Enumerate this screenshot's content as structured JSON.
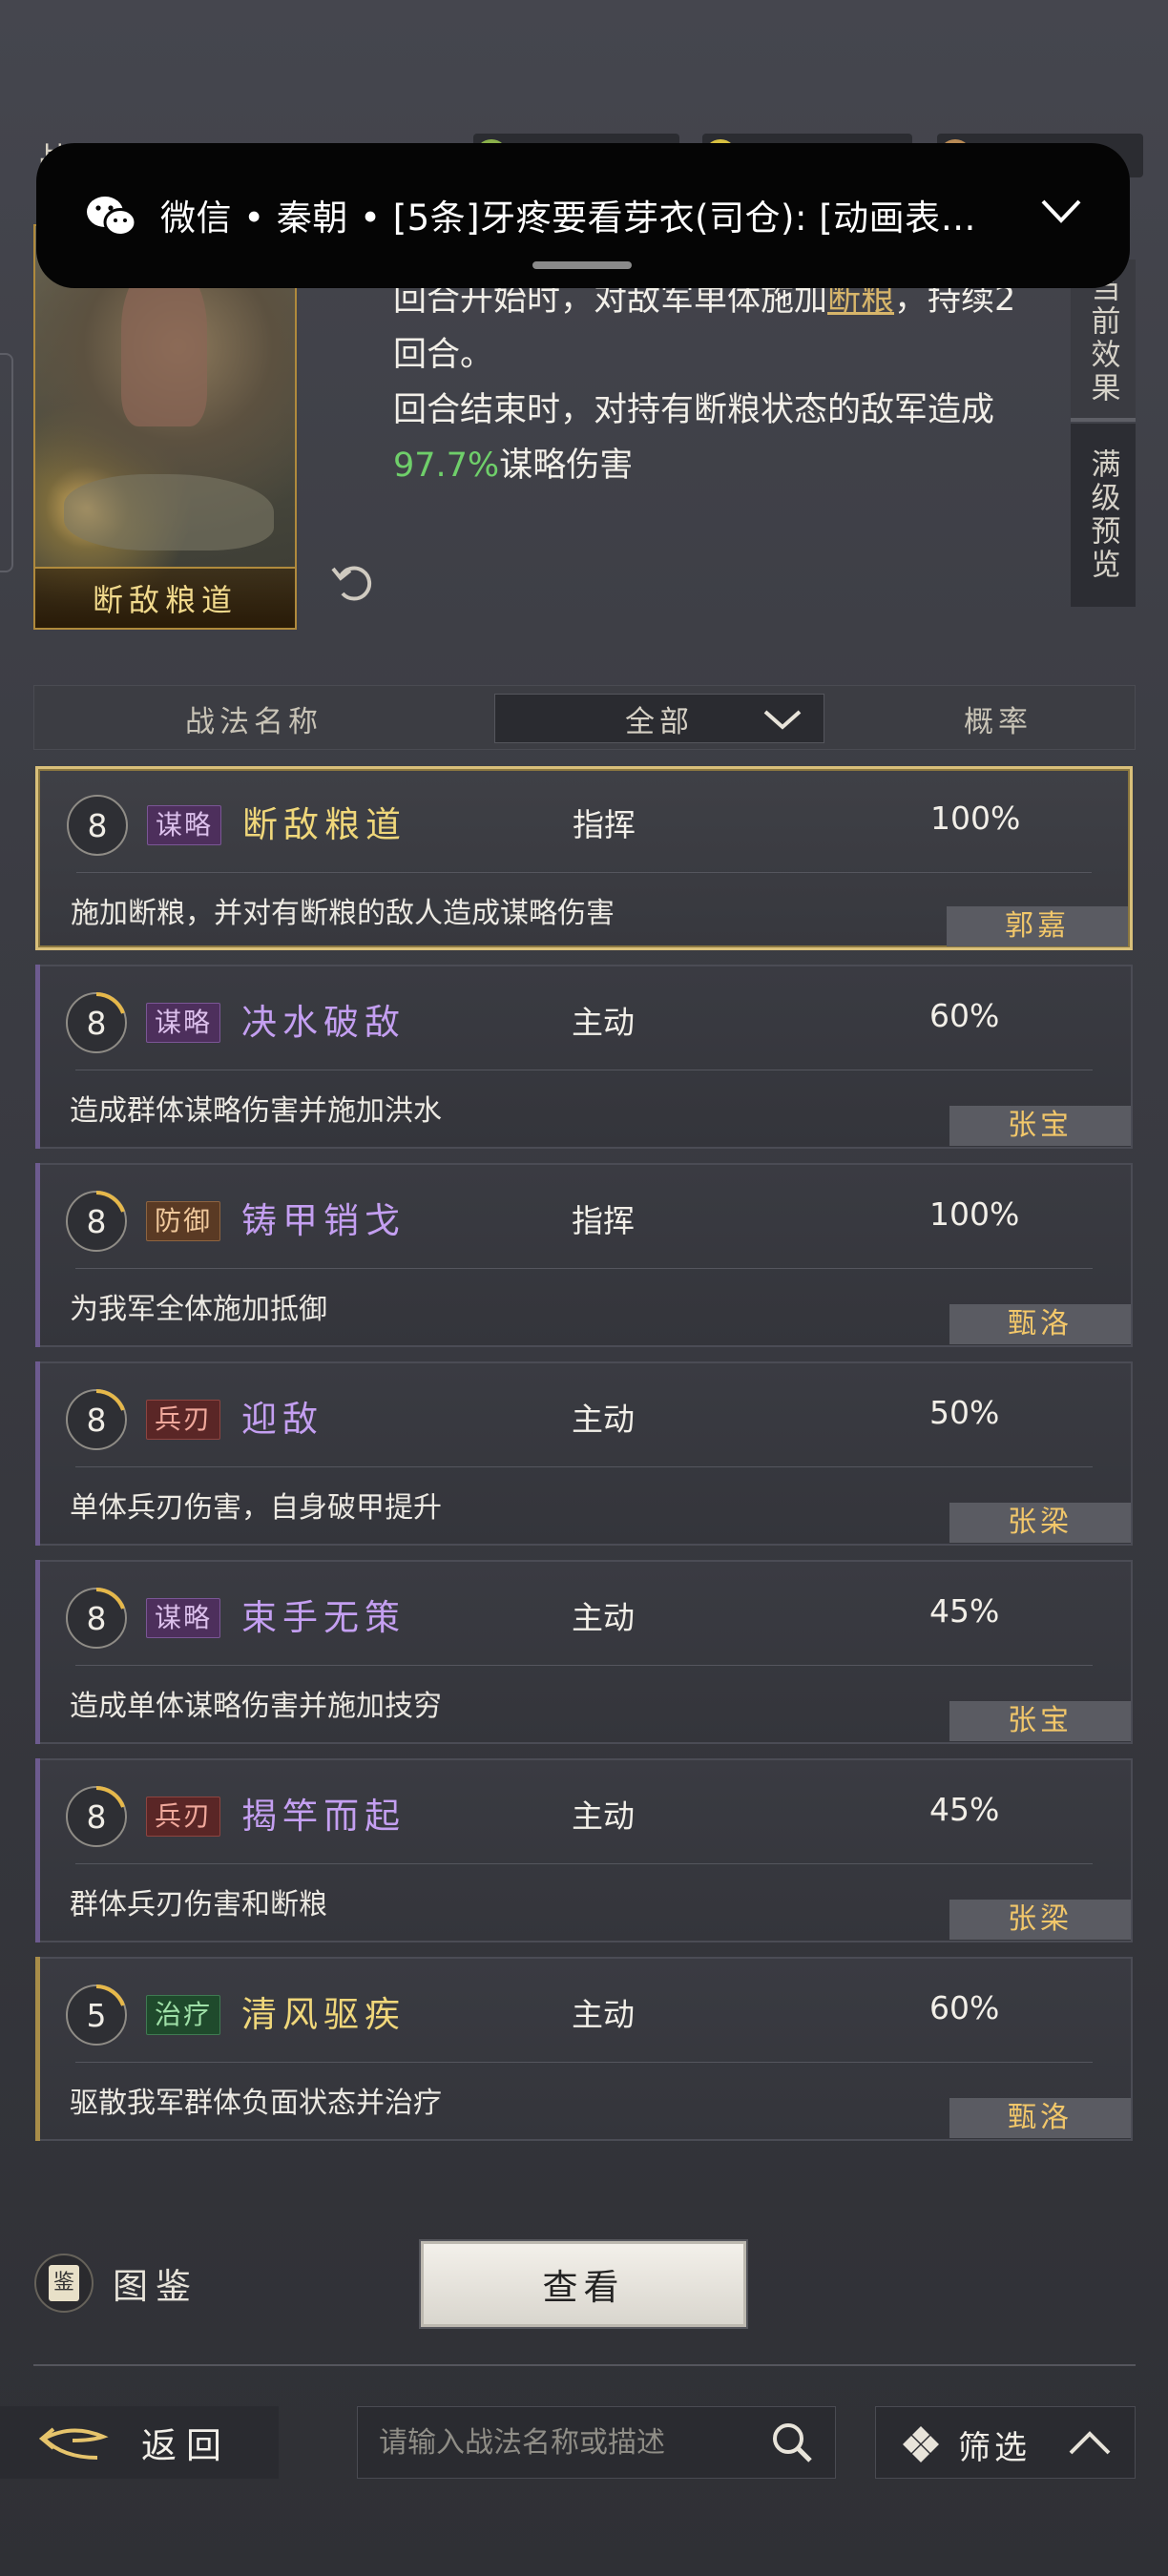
{
  "notification": {
    "text": "微信 • 秦朝 • [5条]牙疼要看芽衣(司仓): [动画表…"
  },
  "header": {
    "label": "战法"
  },
  "skill_card": {
    "art_name": "断敌粮道",
    "desc_line1_pre": "回合开始时，对敌军单体施加",
    "desc_line1_link": "断粮",
    "desc_line1_post": "，持续2",
    "desc_line2": "回合。",
    "desc_line3": "回合结束时，对持有断粮状态的敌军造成",
    "desc_line4_value": "97.7%",
    "desc_line4_text": "谋略伤害",
    "tabs": [
      "当前效果",
      "满级预览"
    ]
  },
  "filter": {
    "col_name": "战法名称",
    "select_value": "全部",
    "col_rate": "概率"
  },
  "skills": [
    {
      "level": "8",
      "tag": "谋略",
      "tag_type": "strat",
      "name": "断敌粮道",
      "name_color": "gold",
      "type": "指挥",
      "rate": "100%",
      "desc": "施加断粮，并对有断粮的敌人造成谋略伤害",
      "general": "郭嘉",
      "selected": true
    },
    {
      "level": "8",
      "tag": "谋略",
      "tag_type": "strat",
      "name": "决水破敌",
      "name_color": "purple",
      "type": "主动",
      "rate": "60%",
      "desc": "造成群体谋略伤害并施加洪水",
      "general": "张宝"
    },
    {
      "level": "8",
      "tag": "防御",
      "tag_type": "def",
      "name": "铸甲销戈",
      "name_color": "purple",
      "type": "指挥",
      "rate": "100%",
      "desc": "为我军全体施加抵御",
      "general": "甄洛"
    },
    {
      "level": "8",
      "tag": "兵刃",
      "tag_type": "blade",
      "name": "迎敌",
      "name_color": "purple",
      "type": "主动",
      "rate": "50%",
      "desc": "单体兵刃伤害，自身破甲提升",
      "general": "张梁"
    },
    {
      "level": "8",
      "tag": "谋略",
      "tag_type": "strat",
      "name": "束手无策",
      "name_color": "purple",
      "type": "主动",
      "rate": "45%",
      "desc": "造成单体谋略伤害并施加技穷",
      "general": "张宝"
    },
    {
      "level": "8",
      "tag": "兵刃",
      "tag_type": "blade",
      "name": "揭竿而起",
      "name_color": "purple",
      "type": "主动",
      "rate": "45%",
      "desc": "群体兵刃伤害和断粮",
      "general": "张梁"
    },
    {
      "level": "5",
      "tag": "治疗",
      "tag_type": "heal",
      "name": "清风驱疾",
      "name_color": "gold",
      "type": "主动",
      "rate": "60%",
      "desc": "驱散我军群体负面状态并治疗",
      "general": "甄洛"
    }
  ],
  "bottom": {
    "codex_label": "图鉴",
    "codex_icon_char": "鉴",
    "view_button": "查看",
    "back_label": "返回",
    "search_placeholder": "请输入战法名称或描述",
    "filter_label": "筛选"
  },
  "colors": {
    "accent_gold": "#f0d77a",
    "skill_purple": "#c49ff1",
    "percent_green": "#6fcf6a",
    "general_gold": "#f2c76a"
  }
}
